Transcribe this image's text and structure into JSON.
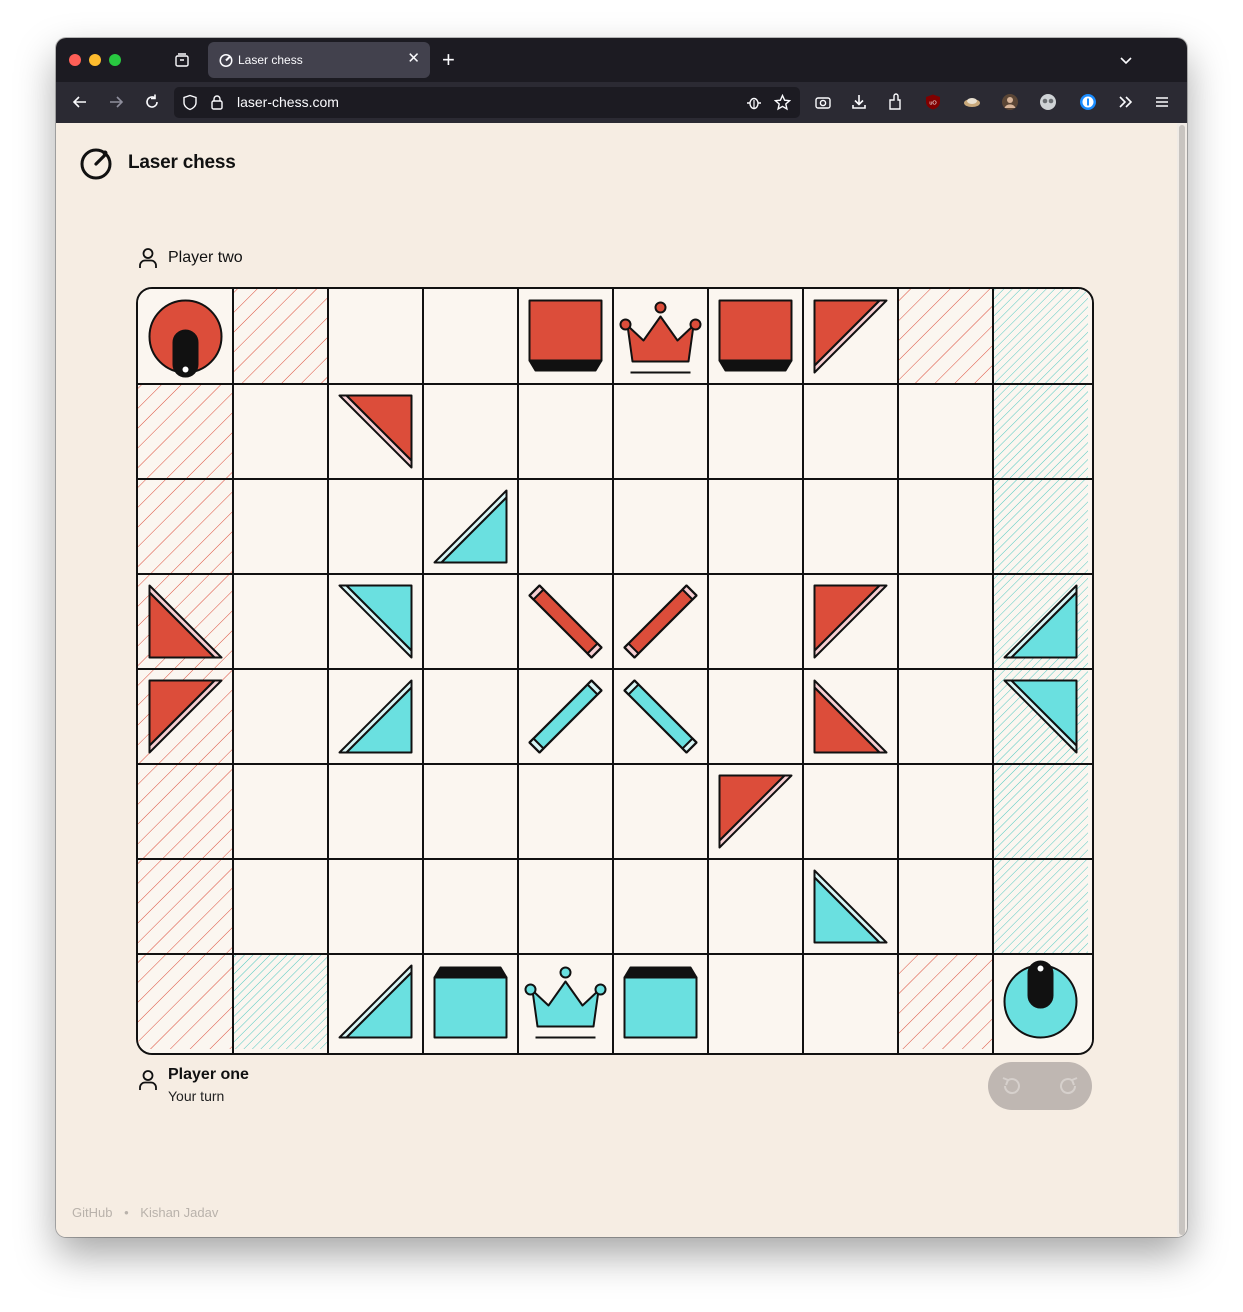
{
  "browser": {
    "tab_title": "Laser chess",
    "url": "laser-chess.com",
    "icons": [
      "tab-overview-icon",
      "back-icon",
      "forward-icon",
      "reload-icon",
      "shield-icon",
      "lock-icon",
      "bug-icon",
      "bookmark-star-icon",
      "screenshot-icon",
      "download-icon",
      "extensions-icon",
      "ublock-icon",
      "extension-icon",
      "avatar-icon",
      "extension-icon",
      "onepassword-icon",
      "overflow-icon",
      "menu-icon"
    ]
  },
  "app": {
    "title": "Laser chess"
  },
  "players": {
    "two": {
      "name": "Player two"
    },
    "one": {
      "name": "Player one",
      "status": "Your turn"
    }
  },
  "colors": {
    "red": "#dc4d3a",
    "red_light": "#f7cfd3",
    "cyan": "#6ae0e0",
    "cyan_light": "#d8f6f6",
    "board": "#fbf6f0",
    "page": "#f6ede3"
  },
  "board": {
    "cols": 10,
    "rows": 8,
    "zones": {
      "red": [
        [
          1,
          0
        ],
        [
          8,
          0
        ],
        [
          0,
          1
        ],
        [
          0,
          2
        ],
        [
          0,
          3
        ],
        [
          0,
          4
        ],
        [
          0,
          5
        ],
        [
          0,
          6
        ],
        [
          0,
          7
        ],
        [
          8,
          7
        ]
      ],
      "cyan": [
        [
          9,
          0
        ],
        [
          9,
          1
        ],
        [
          9,
          2
        ],
        [
          9,
          3
        ],
        [
          9,
          4
        ],
        [
          9,
          5
        ],
        [
          9,
          6
        ],
        [
          1,
          7
        ]
      ]
    },
    "pieces": [
      {
        "col": 0,
        "row": 0,
        "type": "laser",
        "team": "red",
        "rot": 0
      },
      {
        "col": 4,
        "row": 0,
        "type": "defender",
        "team": "red",
        "rot": 0
      },
      {
        "col": 5,
        "row": 0,
        "type": "king",
        "team": "red",
        "rot": 0
      },
      {
        "col": 6,
        "row": 0,
        "type": "defender",
        "team": "red",
        "rot": 0
      },
      {
        "col": 7,
        "row": 0,
        "type": "deflector",
        "team": "red",
        "rot": 0
      },
      {
        "col": 2,
        "row": 1,
        "type": "deflector",
        "team": "red",
        "rot": 90
      },
      {
        "col": 3,
        "row": 2,
        "type": "deflector",
        "team": "cyan",
        "rot": 180
      },
      {
        "col": 0,
        "row": 3,
        "type": "deflector",
        "team": "red",
        "rot": 270
      },
      {
        "col": 2,
        "row": 3,
        "type": "deflector",
        "team": "cyan",
        "rot": 90
      },
      {
        "col": 4,
        "row": 3,
        "type": "switch",
        "team": "red",
        "rot": 0
      },
      {
        "col": 5,
        "row": 3,
        "type": "switch",
        "team": "red",
        "rot": 90
      },
      {
        "col": 7,
        "row": 3,
        "type": "deflector",
        "team": "red",
        "rot": 0
      },
      {
        "col": 9,
        "row": 3,
        "type": "deflector",
        "team": "cyan",
        "rot": 180
      },
      {
        "col": 0,
        "row": 4,
        "type": "deflector",
        "team": "red",
        "rot": 0
      },
      {
        "col": 2,
        "row": 4,
        "type": "deflector",
        "team": "cyan",
        "rot": 180
      },
      {
        "col": 4,
        "row": 4,
        "type": "switch",
        "team": "cyan",
        "rot": 90
      },
      {
        "col": 5,
        "row": 4,
        "type": "switch",
        "team": "cyan",
        "rot": 0
      },
      {
        "col": 7,
        "row": 4,
        "type": "deflector",
        "team": "red",
        "rot": 270
      },
      {
        "col": 9,
        "row": 4,
        "type": "deflector",
        "team": "cyan",
        "rot": 90
      },
      {
        "col": 6,
        "row": 5,
        "type": "deflector",
        "team": "red",
        "rot": 0
      },
      {
        "col": 7,
        "row": 6,
        "type": "deflector",
        "team": "cyan",
        "rot": 270
      },
      {
        "col": 2,
        "row": 7,
        "type": "deflector",
        "team": "cyan",
        "rot": 180
      },
      {
        "col": 3,
        "row": 7,
        "type": "defender",
        "team": "cyan",
        "rot": 180
      },
      {
        "col": 4,
        "row": 7,
        "type": "king",
        "team": "cyan",
        "rot": 0
      },
      {
        "col": 5,
        "row": 7,
        "type": "defender",
        "team": "cyan",
        "rot": 180
      },
      {
        "col": 9,
        "row": 7,
        "type": "laser",
        "team": "cyan",
        "rot": 180
      }
    ]
  },
  "controls": {
    "undo": "undo-icon",
    "redo": "redo-icon"
  },
  "footer": {
    "github": "GitHub",
    "separator": "•",
    "author": "Kishan Jadav"
  }
}
